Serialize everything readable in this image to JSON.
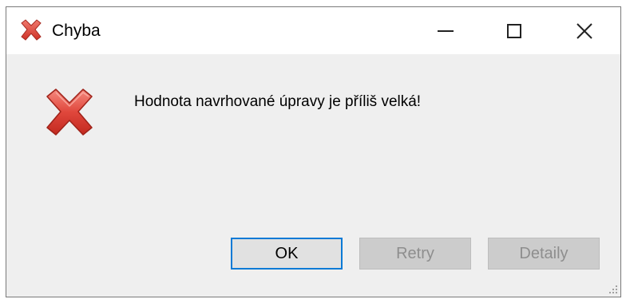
{
  "window": {
    "title": "Chyba"
  },
  "title_controls": {
    "minimize": "minimize",
    "maximize": "maximize",
    "close": "close"
  },
  "message": "Hodnota navrhované úpravy je příliš velká!",
  "buttons": {
    "ok_label": "OK",
    "retry_label": "Retry",
    "detail_label": "Detaily"
  },
  "icons": {
    "title": "error-x-icon",
    "body": "error-x-icon"
  },
  "colors": {
    "error_red": "#e0443a",
    "focus_blue": "#0a7ad6"
  }
}
